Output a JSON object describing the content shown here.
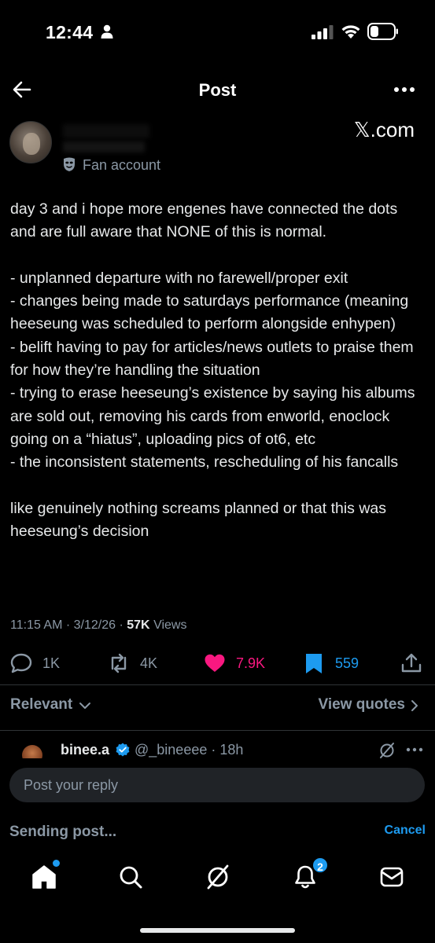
{
  "status_bar": {
    "time": "12:44"
  },
  "nav": {
    "title": "Post"
  },
  "author": {
    "badge_label": "Fan account",
    "source_logo": "𝕏.com"
  },
  "post": {
    "text": "day 3 and i hope more engenes have connected the dots and are full aware that NONE of this is normal.\n\n- unplanned departure with no farewell/proper exit\n- changes being made to saturdays performance (meaning heeseung was scheduled to perform alongside enhypen)\n- belift having to pay for articles/news outlets to praise them for how they’re handling the situation\n- trying to erase heeseung’s existence by saying his albums are sold out, removing his cards from enworld, enoclock going on a “hiatus”, uploading pics of ot6, etc\n- the inconsistent statements, rescheduling of his fancalls\n\nlike genuinely nothing screams planned or that this was heeseung’s decision",
    "time": "11:15 AM",
    "date": "3/12/26",
    "views_count": "57K",
    "views_label": "Views"
  },
  "actions": {
    "replies": "1K",
    "reposts": "4K",
    "likes": "7.9K",
    "bookmarks": "559",
    "like_color": "#f91880",
    "bookmark_color": "#1d9bf0"
  },
  "sort": {
    "label": "Relevant",
    "quotes_label": "View quotes"
  },
  "reply": {
    "name": "binee.a",
    "handle_time": "@_bineeee · 18h"
  },
  "composer": {
    "placeholder": "Post your reply"
  },
  "sending": {
    "label": "Sending post...",
    "cancel": "Cancel"
  },
  "tabs": {
    "items": [
      "home-icon",
      "search-icon",
      "grok-icon",
      "notifications-icon",
      "messages-icon"
    ],
    "notifications_badge": "2"
  },
  "colors": {
    "accent": "#1d9bf0",
    "background": "#000000",
    "muted": "#8b98a5"
  }
}
